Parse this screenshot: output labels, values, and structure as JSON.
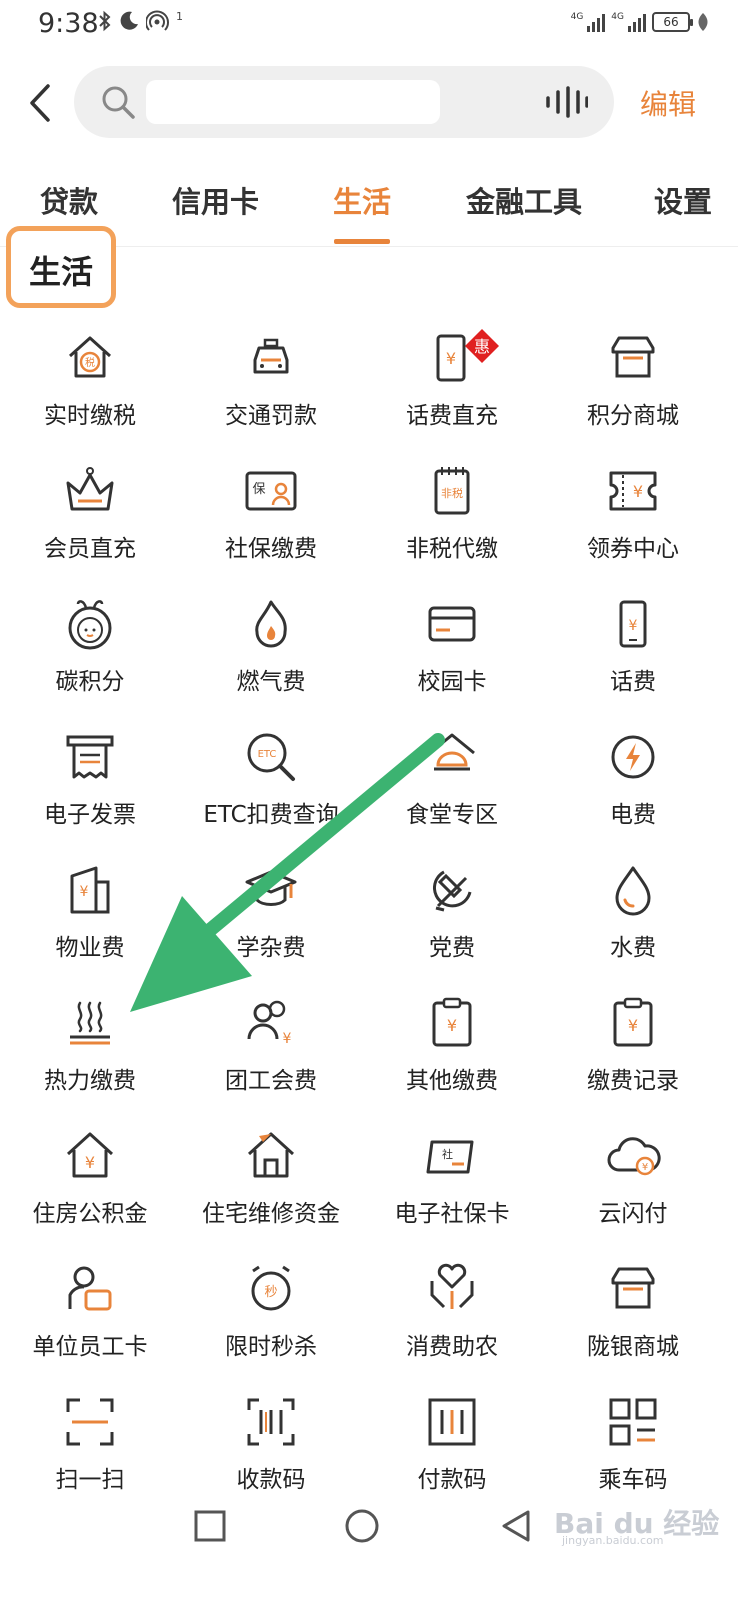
{
  "status_bar": {
    "time": "9:38",
    "hotspot_count": "1",
    "network1": "4G",
    "network2": "4G",
    "battery": "66"
  },
  "search": {
    "placeholder": "",
    "edit_label": "编辑"
  },
  "tabs": [
    {
      "label": "贷款",
      "active": false
    },
    {
      "label": "信用卡",
      "active": false
    },
    {
      "label": "生活",
      "active": true
    },
    {
      "label": "金融工具",
      "active": false
    },
    {
      "label": "设置",
      "active": false
    }
  ],
  "section": {
    "title": "生活"
  },
  "grid": {
    "rows": [
      [
        {
          "label": "实时缴税",
          "icon": "tax-house-icon"
        },
        {
          "label": "交通罚款",
          "icon": "car-icon"
        },
        {
          "label": "话费直充",
          "icon": "phone-recharge-icon",
          "badge": "惠"
        },
        {
          "label": "积分商城",
          "icon": "store-icon"
        }
      ],
      [
        {
          "label": "会员直充",
          "icon": "crown-icon"
        },
        {
          "label": "社保缴费",
          "icon": "social-security-card-icon"
        },
        {
          "label": "非税代缴",
          "icon": "non-tax-notebook-icon"
        },
        {
          "label": "领券中心",
          "icon": "coupon-icon"
        }
      ],
      [
        {
          "label": "碳积分",
          "icon": "carbon-mascot-icon"
        },
        {
          "label": "燃气费",
          "icon": "flame-icon"
        },
        {
          "label": "校园卡",
          "icon": "campus-card-icon"
        },
        {
          "label": "话费",
          "icon": "mobile-yuan-icon"
        }
      ],
      [
        {
          "label": "电子发票",
          "icon": "invoice-icon"
        },
        {
          "label": "ETC扣费查询",
          "icon": "etc-search-icon"
        },
        {
          "label": "食堂专区",
          "icon": "canteen-icon"
        },
        {
          "label": "电费",
          "icon": "lightning-icon"
        }
      ],
      [
        {
          "label": "物业费",
          "icon": "property-building-icon"
        },
        {
          "label": "学杂费",
          "icon": "graduation-cap-icon"
        },
        {
          "label": "党费",
          "icon": "party-emblem-icon"
        },
        {
          "label": "水费",
          "icon": "water-drop-icon"
        }
      ],
      [
        {
          "label": "热力缴费",
          "icon": "heat-icon"
        },
        {
          "label": "团工会费",
          "icon": "union-people-icon"
        },
        {
          "label": "其他缴费",
          "icon": "clipboard-yuan-icon"
        },
        {
          "label": "缴费记录",
          "icon": "payment-record-icon"
        }
      ],
      [
        {
          "label": "住房公积金",
          "icon": "housing-fund-icon"
        },
        {
          "label": "住宅维修资金",
          "icon": "house-icon"
        },
        {
          "label": "电子社保卡",
          "icon": "e-social-card-icon"
        },
        {
          "label": "云闪付",
          "icon": "cloud-pay-icon"
        }
      ],
      [
        {
          "label": "单位员工卡",
          "icon": "employee-card-icon"
        },
        {
          "label": "限时秒杀",
          "icon": "alarm-clock-icon"
        },
        {
          "label": "消费助农",
          "icon": "heart-hand-icon"
        },
        {
          "label": "陇银商城",
          "icon": "shop-icon"
        }
      ],
      [
        {
          "label": "扫一扫",
          "icon": "scan-icon"
        },
        {
          "label": "收款码",
          "icon": "receive-code-icon"
        },
        {
          "label": "付款码",
          "icon": "pay-code-icon"
        },
        {
          "label": "乘车码",
          "icon": "ride-code-icon"
        }
      ]
    ]
  },
  "watermark": {
    "text": "Bai du 经验",
    "sub": "jingyan.baidu.com"
  },
  "colors": {
    "accent": "#e8843b",
    "highlight": "#f3a25a",
    "arrow": "#3cb371",
    "icon_stroke": "#333333"
  }
}
